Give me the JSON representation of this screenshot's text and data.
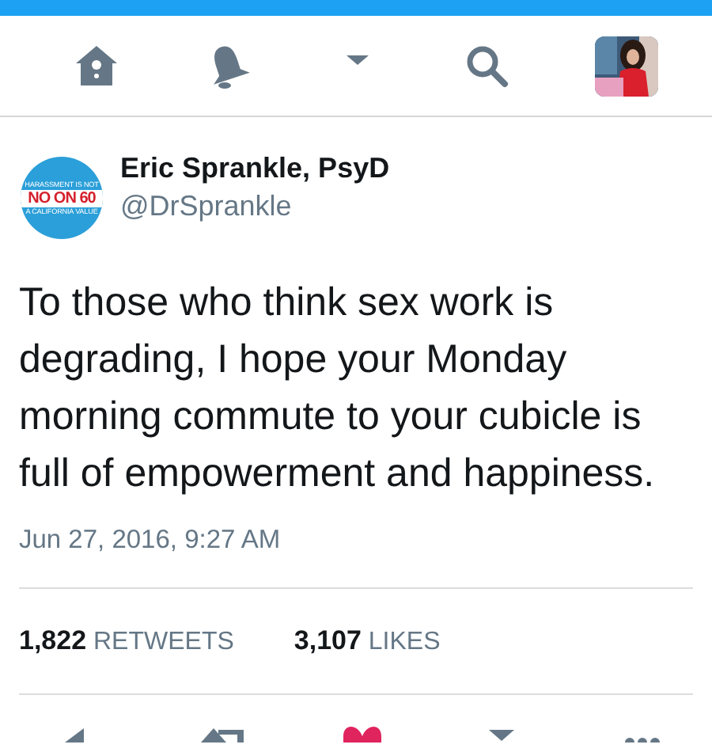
{
  "nav": {
    "items": [
      {
        "kind": "home"
      },
      {
        "kind": "notifications"
      },
      {
        "kind": "dropdown"
      },
      {
        "kind": "search"
      },
      {
        "kind": "profile"
      }
    ]
  },
  "tweet": {
    "avatar": {
      "top": "HARASSMENT IS NOT",
      "main": "NO ON 60",
      "bottom": "A CALIFORNIA VALUE"
    },
    "name": "Eric Sprankle, PsyD",
    "handle": "@DrSprankle",
    "text": "To those who think sex work is degrading, I hope your Monday morning commute to your cubicle is full of empowerment and happiness.",
    "timestamp": "Jun 27, 2016, 9:27 AM",
    "stats": [
      {
        "count": "1,822",
        "label": "RETWEETS"
      },
      {
        "count": "3,107",
        "label": "LIKES"
      }
    ],
    "actions": [
      {
        "kind": "reply"
      },
      {
        "kind": "retweet"
      },
      {
        "kind": "like",
        "selected": true
      },
      {
        "kind": "dropdown"
      },
      {
        "kind": "more"
      }
    ]
  }
}
